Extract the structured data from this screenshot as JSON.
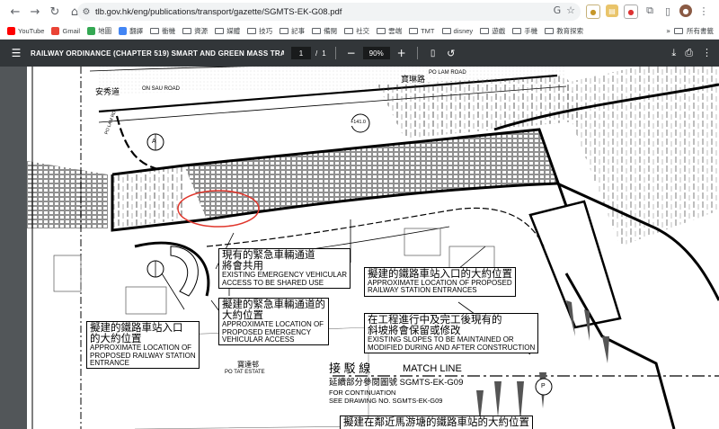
{
  "browser": {
    "url": "tlb.gov.hk/eng/publications/transport/gazette/SGMTS-EK-G08.pdf"
  },
  "bookmarks": [
    {
      "label": "YouTube",
      "color": "#ff0000"
    },
    {
      "label": "Gmail",
      "color": "#ea4335"
    },
    {
      "label": "地圖",
      "color": "#34a853"
    },
    {
      "label": "翻譯",
      "color": "#4285f4"
    }
  ],
  "bookmark_folders": [
    "衝機",
    "資源",
    "媒體",
    "技巧",
    "記事",
    "備閱",
    "社交",
    "雲端",
    "TMT",
    "disney",
    "遊戲",
    "手機",
    "教育探索"
  ],
  "bookmarks_all": "所有書籤",
  "pdf": {
    "title": "RAILWAY ORDINANCE (CHAPTER 519) SMART AND GREEN MASS TRANS...",
    "page_current": "1",
    "page_total": "1",
    "page_sep": "/",
    "zoom": "90%"
  },
  "map": {
    "road_zh_1": "安秀道",
    "road_en_1": "ON SAU ROAD",
    "road_zh_2": "寶琳路",
    "road_en_2": "PO LAM ROAD",
    "road_en_3": "PO LAM RD",
    "level_mark": "+141.0",
    "estate_zh": "寶達邨",
    "estate_en": "PO TAT ESTATE",
    "arrow_letter_1": "A",
    "arrow_letter_2": "P",
    "shared_access": {
      "zh1": "現有的緊急車輛通道",
      "zh2": "將會共用",
      "en1": "EXISTING EMERGENCY VEHICULAR",
      "en2": "ACCESS TO BE SHARED USE"
    },
    "proposed_eva": {
      "zh1": "擬建的緊急車輛通道的",
      "zh2": "大約位置",
      "en1": "APPROXIMATE LOCATION OF",
      "en2": "PROPOSED EMERGENCY",
      "en3": "VEHICULAR ACCESS"
    },
    "station_entrance_left": {
      "zh1": "擬建的鐵路車站入口",
      "zh2": "的大約位置",
      "en1": "APPROXIMATE LOCATION OF",
      "en2": "PROPOSED RAILWAY STATION",
      "en3": "ENTRANCE"
    },
    "station_entrances_right": {
      "zh1": "擬建的鐵路車站入口的大約位置",
      "en1": "APPROXIMATE LOCATION OF PROPOSED",
      "en2": "RAILWAY STATION ENTRANCES"
    },
    "slopes": {
      "zh1": "在工程進行中及完工後現有的",
      "zh2": "斜坡將會保留或修改",
      "en1": "EXISTING SLOPES TO BE MAINTAINED OR",
      "en2": "MODIFIED DURING AND AFTER CONSTRUCTION"
    },
    "match_line": {
      "zh": "接 駁 線",
      "en": "MATCH LINE",
      "cont_zh": "延續部分參閱圖號 SGMTS-EK-G09",
      "cont_en1": "FOR CONTINUATION",
      "cont_en2": "SEE DRAWING NO. SGMTS-EK-G09"
    },
    "bottom_zh": "擬建在鄰近馬游塘的鐵路車站的大約位置"
  }
}
